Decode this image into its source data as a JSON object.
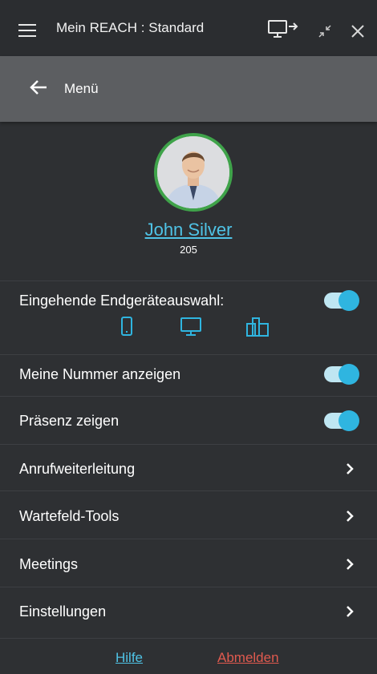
{
  "window": {
    "title": "Mein REACH : Standard"
  },
  "menubar": {
    "label": "Menü"
  },
  "profile": {
    "name": "John Silver",
    "extension": "205"
  },
  "settings": {
    "incoming_device": {
      "label": "Eingehende Endgeräteauswahl:",
      "enabled": true
    },
    "show_number": {
      "label": "Meine Nummer anzeigen",
      "enabled": true
    },
    "show_presence": {
      "label": "Präsenz zeigen",
      "enabled": true
    }
  },
  "nav": {
    "items": [
      {
        "label": "Anrufweiterleitung"
      },
      {
        "label": "Wartefeld-Tools"
      },
      {
        "label": "Meetings"
      },
      {
        "label": "Einstellungen"
      }
    ]
  },
  "footer": {
    "help": "Hilfe",
    "logout": "Abmelden"
  },
  "colors": {
    "accent": "#4fc3e6",
    "toggle_knob": "#2fb5e0",
    "presence_ring": "#3fa34a",
    "logout": "#e05a4f"
  }
}
